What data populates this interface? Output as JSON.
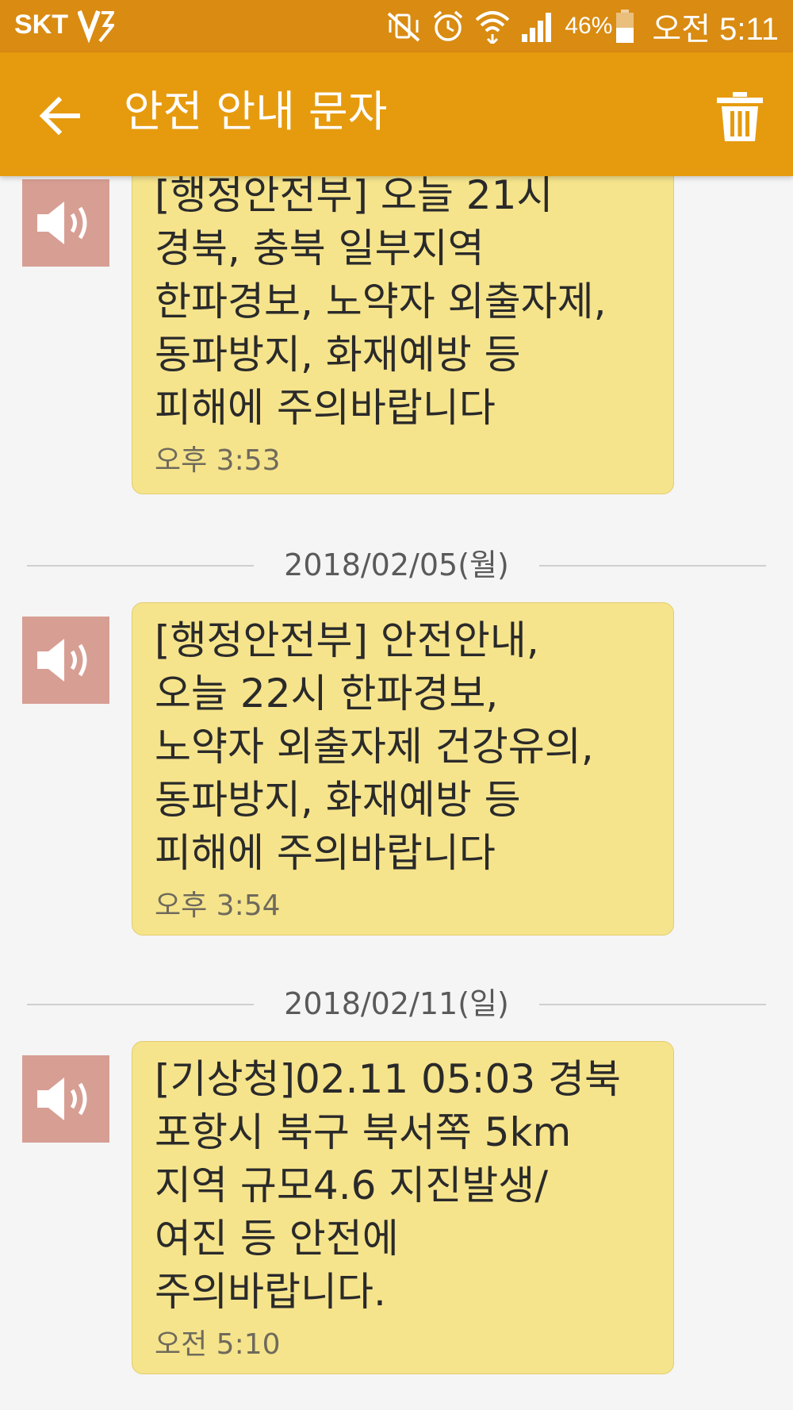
{
  "status_bar": {
    "carrier": "SKT",
    "battery_percent": "46%",
    "time": "오전 5:11",
    "icons": [
      "vibrate-off-icon",
      "alarm-icon",
      "wifi-icon",
      "signal-icon",
      "battery-icon"
    ]
  },
  "app_bar": {
    "title": "안전 안내 문자",
    "back_icon": "arrow-left-icon",
    "delete_icon": "trash-icon"
  },
  "messages": [
    {
      "lines": [
        "[행정안전부] 오늘 21시",
        "경북, 충북 일부지역",
        "한파경보, 노약자 외출자제,",
        "동파방지, 화재예방 등",
        "피해에 주의바랍니다"
      ],
      "time": "오후 3:53"
    },
    {
      "date": "2018/02/05(월)",
      "lines": [
        "[행정안전부] 안전안내,",
        "오늘 22시 한파경보,",
        "노약자 외출자제 건강유의,",
        "동파방지, 화재예방 등",
        "피해에 주의바랍니다"
      ],
      "time": "오후 3:54"
    },
    {
      "date": "2018/02/11(일)",
      "lines": [
        "[기상청]02.11 05:03 경북",
        "포항시 북구 북서쪽 5km",
        "지역 규모4.6 지진발생/",
        "여진 등 안전에",
        "주의바랍니다."
      ],
      "time": "오전 5:10"
    }
  ],
  "colors": {
    "status_bar": "#d98b12",
    "app_bar": "#e69b0e",
    "bubble": "#f6e48c",
    "avatar": "#d79e94",
    "background": "#f5f5f5"
  }
}
